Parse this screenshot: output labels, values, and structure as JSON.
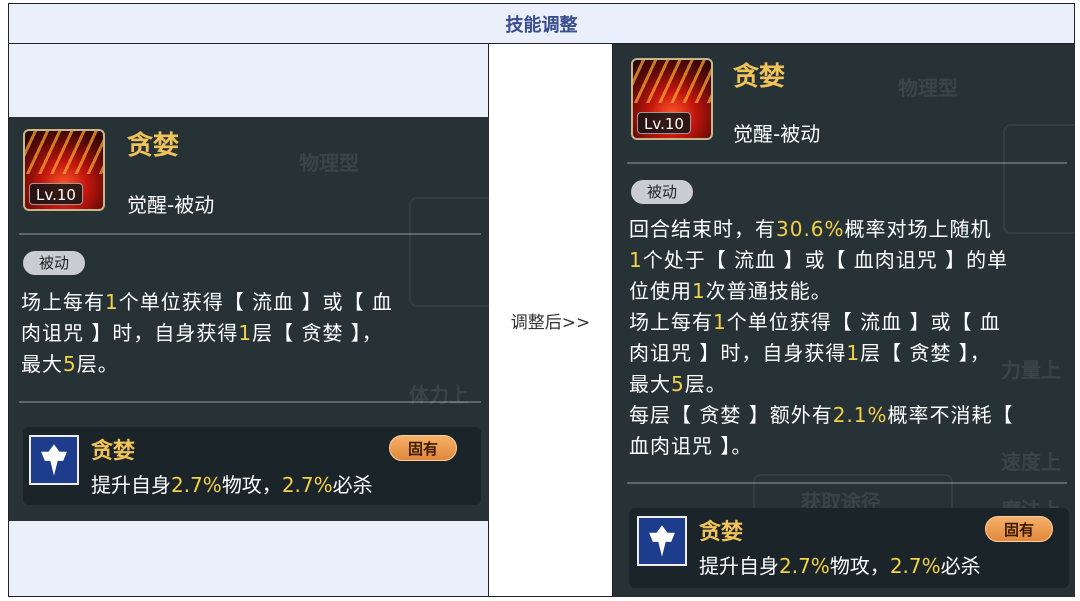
{
  "header": {
    "title": "技能调整"
  },
  "middle": {
    "label": "调整后>>"
  },
  "before": {
    "skill_name": "贪婪",
    "level": "Lv.10",
    "skill_type": "觉醒-被动",
    "tag": "被动",
    "desc": {
      "l1a": "场上每有",
      "l1b": "1",
      "l1c": "个单位获得【 流血 】或【 血",
      "l2a": "肉诅咒 】时，自身获得",
      "l2b": "1",
      "l2c": "层【 贪婪 】，",
      "l3a": "最大",
      "l3b": "5",
      "l3c": "层。"
    },
    "sub": {
      "name": "贪婪",
      "badge": "固有",
      "d1": "提升自身",
      "d2": "2.7%",
      "d3": "物攻，",
      "d4": "2.7%",
      "d5": "必杀"
    },
    "bg_text": [
      "物理型",
      "体力上"
    ]
  },
  "after": {
    "skill_name": "贪婪",
    "level": "Lv.10",
    "skill_type": "觉醒-被动",
    "tag": "被动",
    "desc": {
      "l1a": "回合结束时，有",
      "l1b": "30.6%",
      "l1c": "概率对场上随机",
      "l2a": "1",
      "l2b": "个处于【 流血 】或【 血肉诅咒 】的单",
      "l3a": "位使用",
      "l3b": "1",
      "l3c": "次普通技能。",
      "l4a": "场上每有",
      "l4b": "1",
      "l4c": "个单位获得【 流血 】或【 血",
      "l5a": "肉诅咒 】时，自身获得",
      "l5b": "1",
      "l5c": "层【 贪婪 】，",
      "l6a": "最大",
      "l6b": "5",
      "l6c": "层。",
      "l7a": "每层【 贪婪 】额外有",
      "l7b": "2.1%",
      "l7c": "概率不消耗【",
      "l8a": "血肉诅咒 】。"
    },
    "sub": {
      "name": "贪婪",
      "badge": "固有",
      "d1": "提升自身",
      "d2": "2.7%",
      "d3": "物攻，",
      "d4": "2.7%",
      "d5": "必杀"
    },
    "bg_text": [
      "物理型",
      "获取途径",
      "速度上",
      "魔法上",
      "力量上"
    ]
  },
  "colors": {
    "highlight": "#f2d048",
    "name": "#f0c35a",
    "panel": "#263236",
    "header_bg": "#e9effb",
    "header_text": "#3a4d8c"
  }
}
